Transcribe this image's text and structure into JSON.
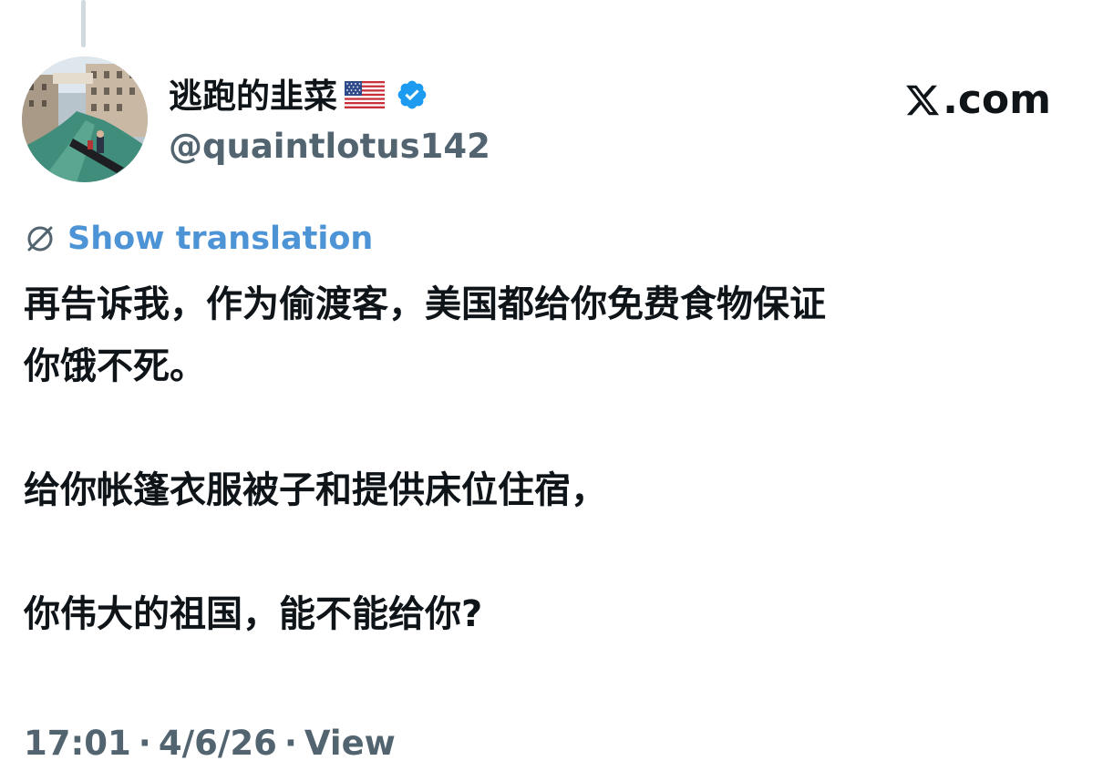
{
  "tweet": {
    "author": {
      "display_name": "逃跑的韭菜",
      "flag_icon": "us-flag-icon",
      "verified": true,
      "verified_icon": "verified-badge-icon",
      "handle": "@quaintlotus142",
      "avatar": "venice-canal-gondola-photo"
    },
    "brand": {
      "logo_icon": "x-logo-icon",
      "domain": ".com"
    },
    "translation": {
      "icon": "globe-translate-icon",
      "label": "Show translation"
    },
    "body": {
      "line1": "再告诉我，作为偷渡客，美国都给你免费食物保证",
      "line2": "你饿不死。",
      "line3": "给你帐篷衣服被子和提供床位住宿，",
      "line4": "你伟大的祖国，能不能给你?"
    },
    "meta": {
      "time": "17:01",
      "separator": "·",
      "date": "4/6/26",
      "views_label": "View"
    }
  },
  "colors": {
    "text_primary": "#0f1419",
    "text_secondary": "#536471",
    "link_blue": "#4d94d6",
    "verified_blue": "#1d9bf0",
    "thread_line": "#cfd9de"
  }
}
